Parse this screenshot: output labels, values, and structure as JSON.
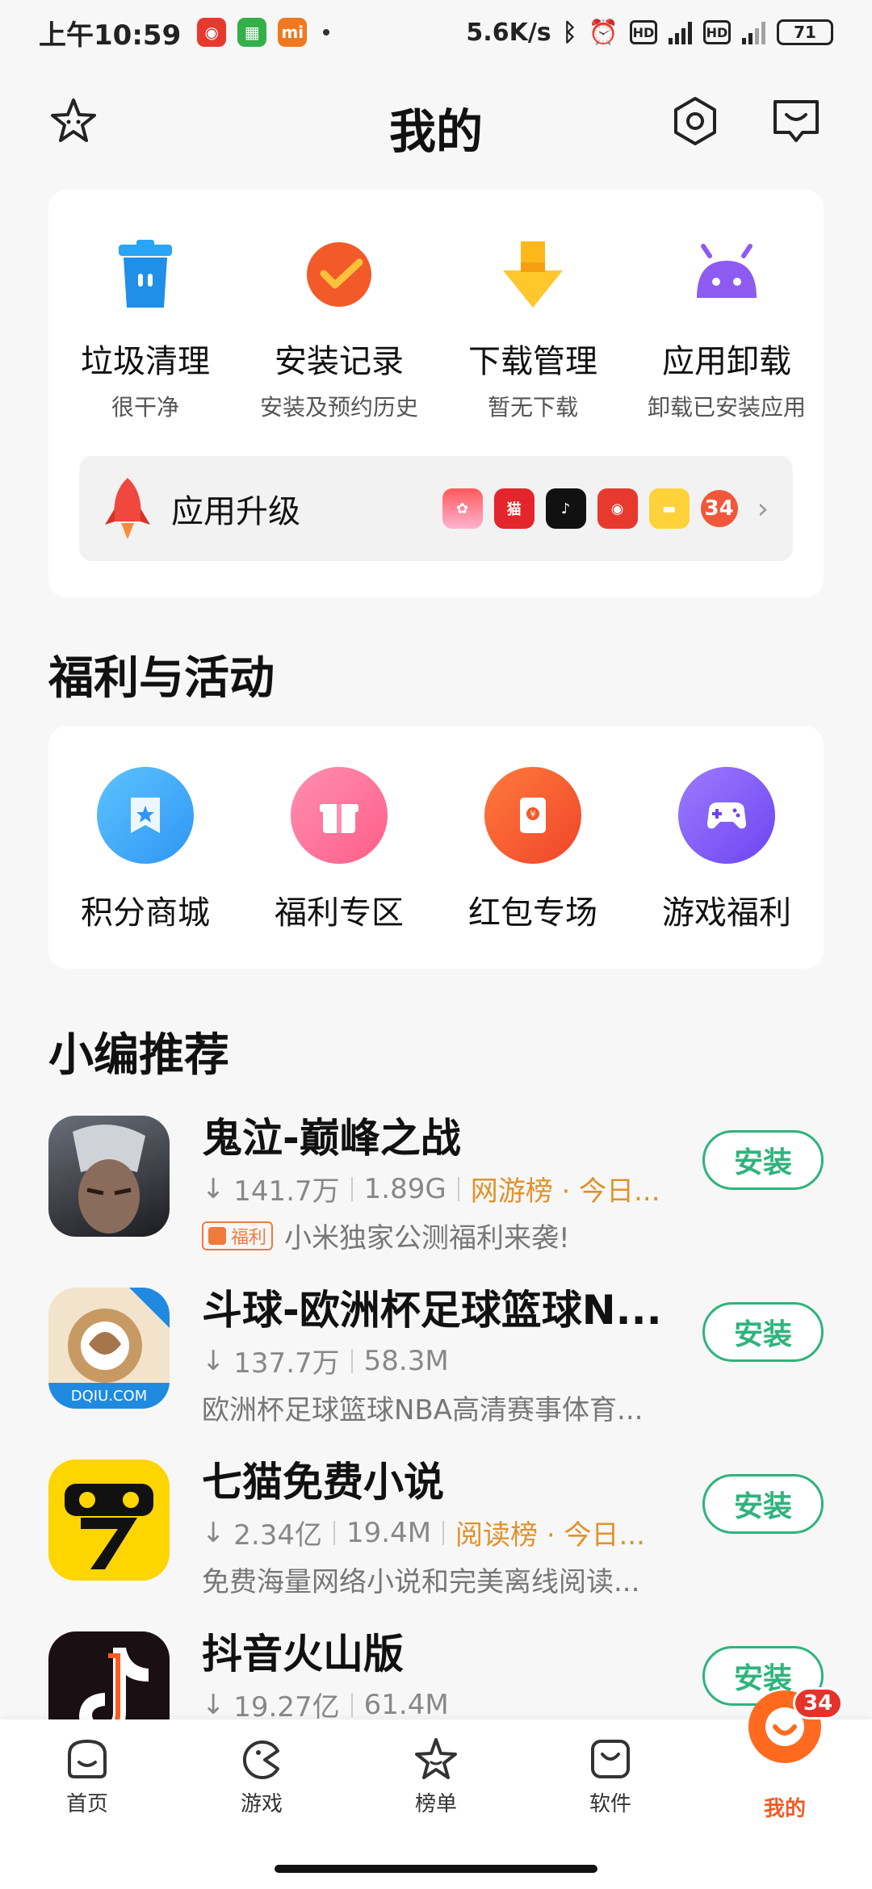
{
  "status_bar": {
    "time": "上午10:59",
    "net_speed": "5.6K/s",
    "network": "4G",
    "hd": "HD",
    "battery": "71"
  },
  "header": {
    "title": "我的"
  },
  "tools": [
    {
      "name": "垃圾清理",
      "sub": "很干净"
    },
    {
      "name": "安装记录",
      "sub": "安装及预约历史"
    },
    {
      "name": "下载管理",
      "sub": "暂无下载"
    },
    {
      "name": "应用卸载",
      "sub": "卸载已安装应用"
    }
  ],
  "upgrade": {
    "label": "应用升级",
    "count": "34"
  },
  "welfare": {
    "title": "福利与活动",
    "items": [
      {
        "name": "积分商城"
      },
      {
        "name": "福利专区"
      },
      {
        "name": "红包专场"
      },
      {
        "name": "游戏福利"
      }
    ]
  },
  "recommend": {
    "title": "小编推荐",
    "install_label": "安装",
    "apps": [
      {
        "name": "鬼泣-巅峰之战",
        "downloads": "141.7万",
        "size": "1.89G",
        "rank": "网游榜 · 今日...",
        "tag": "福利",
        "desc": "小米独家公测福利来袭!"
      },
      {
        "name": "斗球-欧洲杯足球篮球N...",
        "downloads": "137.7万",
        "size": "58.3M",
        "rank": "",
        "tag": "",
        "desc": "欧洲杯足球篮球NBA高清赛事体育..."
      },
      {
        "name": "七猫免费小说",
        "downloads": "2.34亿",
        "size": "19.4M",
        "rank": "阅读榜 · 今日...",
        "tag": "",
        "desc": "免费海量网络小说和完美离线阅读..."
      },
      {
        "name": "抖音火山版",
        "downloads": "19.27亿",
        "size": "61.4M",
        "rank": "",
        "tag": "",
        "desc": ""
      }
    ]
  },
  "bottom_nav": {
    "items": [
      {
        "label": "首页"
      },
      {
        "label": "游戏"
      },
      {
        "label": "榜单"
      },
      {
        "label": "软件"
      },
      {
        "label": "我的"
      }
    ],
    "badge": "34"
  },
  "colors": {
    "accent": "#f05b24",
    "install_green": "#2fb37c",
    "rank_orange": "#e0922a"
  }
}
